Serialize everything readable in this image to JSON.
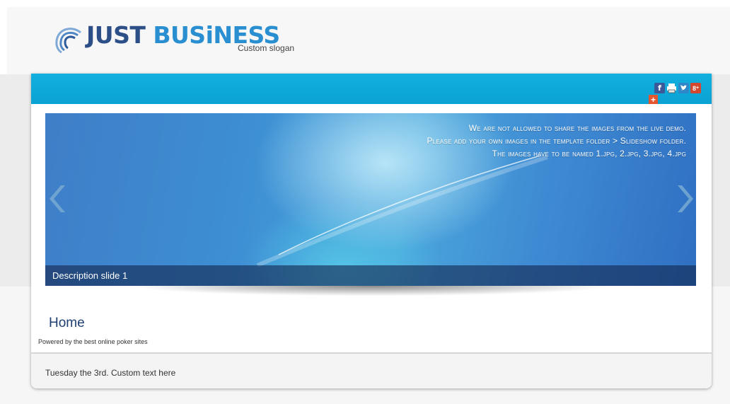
{
  "header": {
    "brand_part1": "JUST",
    "brand_part2": "BUSiNESS",
    "slogan": "Custom slogan"
  },
  "social": {
    "icons": [
      "facebook-icon",
      "print-icon",
      "twitter-icon",
      "google-plus-icon",
      "addthis-plus-icon"
    ]
  },
  "slideshow": {
    "notice_lines": [
      "We are not allowed to share the images from the live demo.",
      "Please add your own images in the template folder > Slideshow folder.",
      "The images have to be named  1.jpg, 2.jpg, 3.jpg, 4.jpg"
    ],
    "caption": "Description slide 1",
    "prev_icon": "chevron-left-icon",
    "next_icon": "chevron-right-icon"
  },
  "content": {
    "title": "Home",
    "powered": "Powered by the best online poker sites"
  },
  "footer": {
    "text": "Tuesday the 3rd. Custom text here"
  },
  "colors": {
    "topbar": "#0aa2d3",
    "brand_dark": "#2d4f88",
    "brand_light": "#2a8fd0",
    "title": "#1f3f72"
  }
}
